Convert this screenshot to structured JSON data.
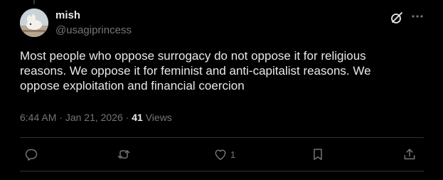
{
  "author": {
    "display_name": "mish",
    "handle": "@usagiprincess"
  },
  "tweet": {
    "text": "Most people who oppose surrogacy do not oppose it for religious\nreasons. We oppose it for feminist and anti-capitalist reasons. We\noppose exploitation and financial coercion",
    "time": "6:44 AM",
    "separator": "·",
    "date": "Jan 21, 2026",
    "views_count": "41",
    "views_label": "Views"
  },
  "actions": {
    "reply_icon": "reply-icon",
    "retweet_icon": "retweet-icon",
    "like_icon": "heart-icon",
    "like_count": "1",
    "bookmark_icon": "bookmark-icon",
    "share_icon": "share-icon"
  },
  "header_icons": [
    "grok-icon",
    "more-icon"
  ],
  "colors": {
    "background": "#000000",
    "primary_text": "#e7e9ea",
    "secondary_text": "#71767b",
    "divider": "#2f3336"
  }
}
